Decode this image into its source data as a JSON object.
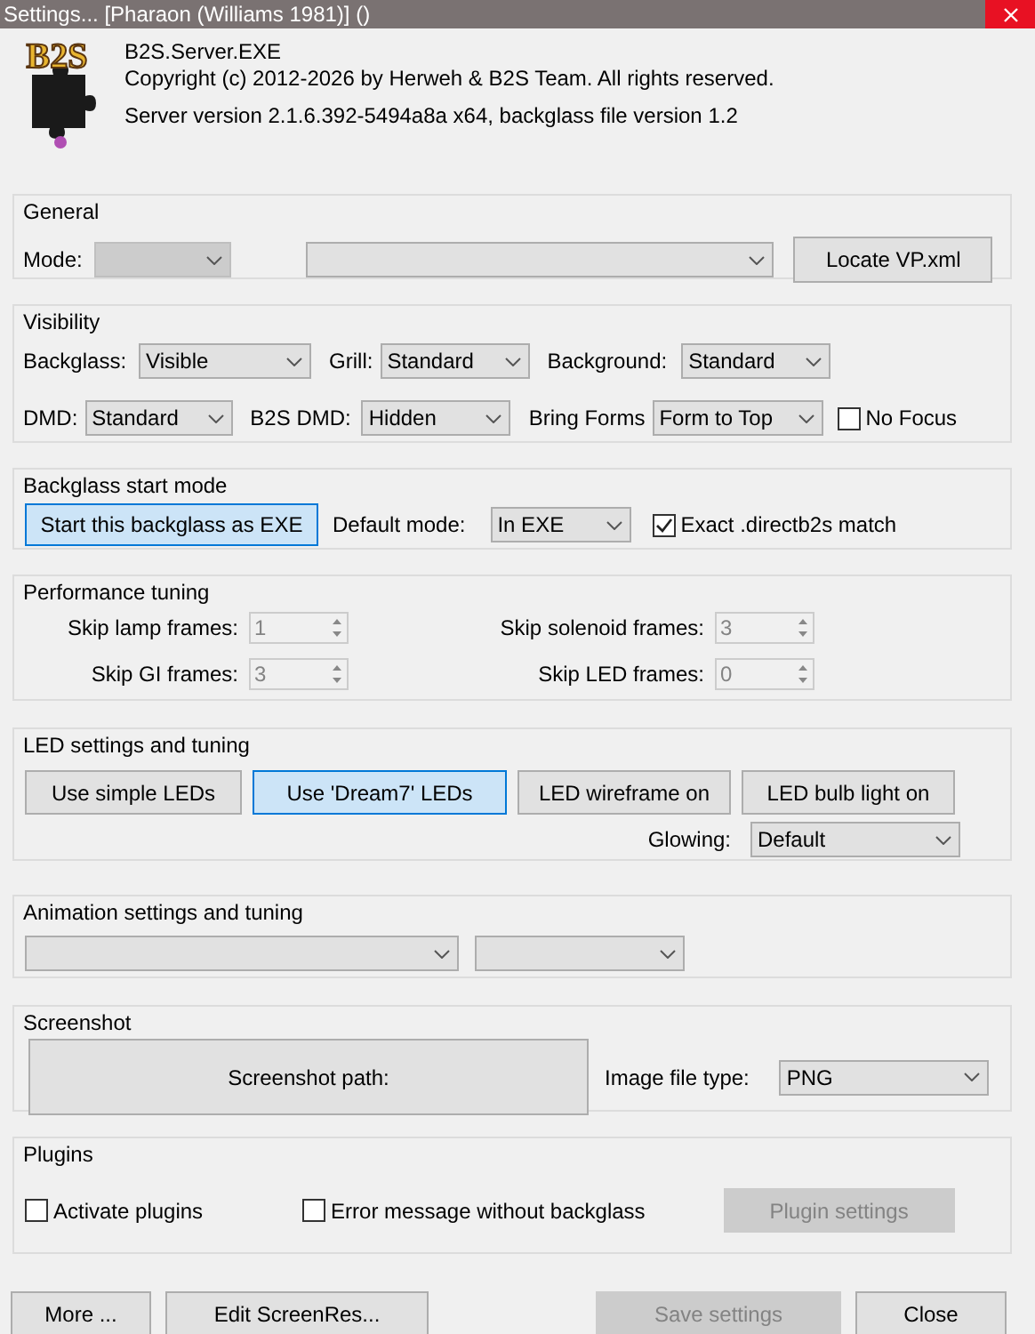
{
  "window": {
    "title": "Settings... [Pharaon (Williams 1981)]  ()"
  },
  "header": {
    "logo_text": "B2S",
    "product": "B2S.Server.EXE",
    "copyright": "Copyright (c) 2012-2026 by Herweh & B2S Team. All rights reserved.",
    "version": "Server version 2.1.6.392-5494a8a x64, backglass file version 1.2"
  },
  "general": {
    "title": "General",
    "mode_label": "Mode:",
    "locate_button": "Locate VP.xml"
  },
  "visibility": {
    "title": "Visibility",
    "fields": [
      {
        "label": "Backglass:",
        "value": "Visible"
      },
      {
        "label": "Grill:",
        "value": "Standard"
      },
      {
        "label": "Background:",
        "value": "Standard"
      },
      {
        "label": "DMD:",
        "value": "Standard"
      },
      {
        "label": "B2S DMD:",
        "value": "Hidden"
      },
      {
        "label": "Bring Forms",
        "value": "Form to Top"
      }
    ],
    "no_focus": {
      "label": "No Focus",
      "checked": false
    }
  },
  "start_mode": {
    "title": "Backglass start mode",
    "start_button": {
      "label": "Start this backglass as EXE",
      "selected": true
    },
    "default_mode_label": "Default mode:",
    "default_mode": "In EXE",
    "exact_match": {
      "label": "Exact .directb2s match",
      "checked": true
    }
  },
  "performance": {
    "title": "Performance tuning",
    "spinners": [
      {
        "label": "Skip lamp frames:",
        "value": "1",
        "disabled": true
      },
      {
        "label": "Skip solenoid frames:",
        "value": "3",
        "disabled": true
      },
      {
        "label": "Skip GI frames:",
        "value": "3",
        "disabled": true
      },
      {
        "label": "Skip LED frames:",
        "value": "0",
        "disabled": true
      }
    ]
  },
  "led": {
    "title": "LED settings and tuning",
    "buttons": [
      {
        "label": "Use simple LEDs",
        "selected": false
      },
      {
        "label": "Use 'Dream7' LEDs",
        "selected": true
      },
      {
        "label": "LED wireframe on",
        "selected": false
      },
      {
        "label": "LED bulb light on",
        "selected": false
      }
    ],
    "glowing_label": "Glowing:",
    "glowing": "Default"
  },
  "animation": {
    "title": "Animation settings and tuning"
  },
  "screenshot": {
    "title": "Screenshot",
    "path_button": "Screenshot path:",
    "file_type_label": "Image file type:",
    "file_type": "PNG"
  },
  "plugins": {
    "title": "Plugins",
    "checks": [
      {
        "label": "Activate plugins",
        "checked": false
      },
      {
        "label": "Error message without backglass",
        "checked": false
      }
    ],
    "settings_button": {
      "label": "Plugin settings",
      "disabled": true
    }
  },
  "footer": {
    "buttons": [
      {
        "label": "More ...",
        "disabled": false
      },
      {
        "label": "Edit ScreenRes...",
        "disabled": false
      },
      {
        "label": "Save settings",
        "disabled": true
      },
      {
        "label": "Close",
        "disabled": false
      }
    ]
  }
}
